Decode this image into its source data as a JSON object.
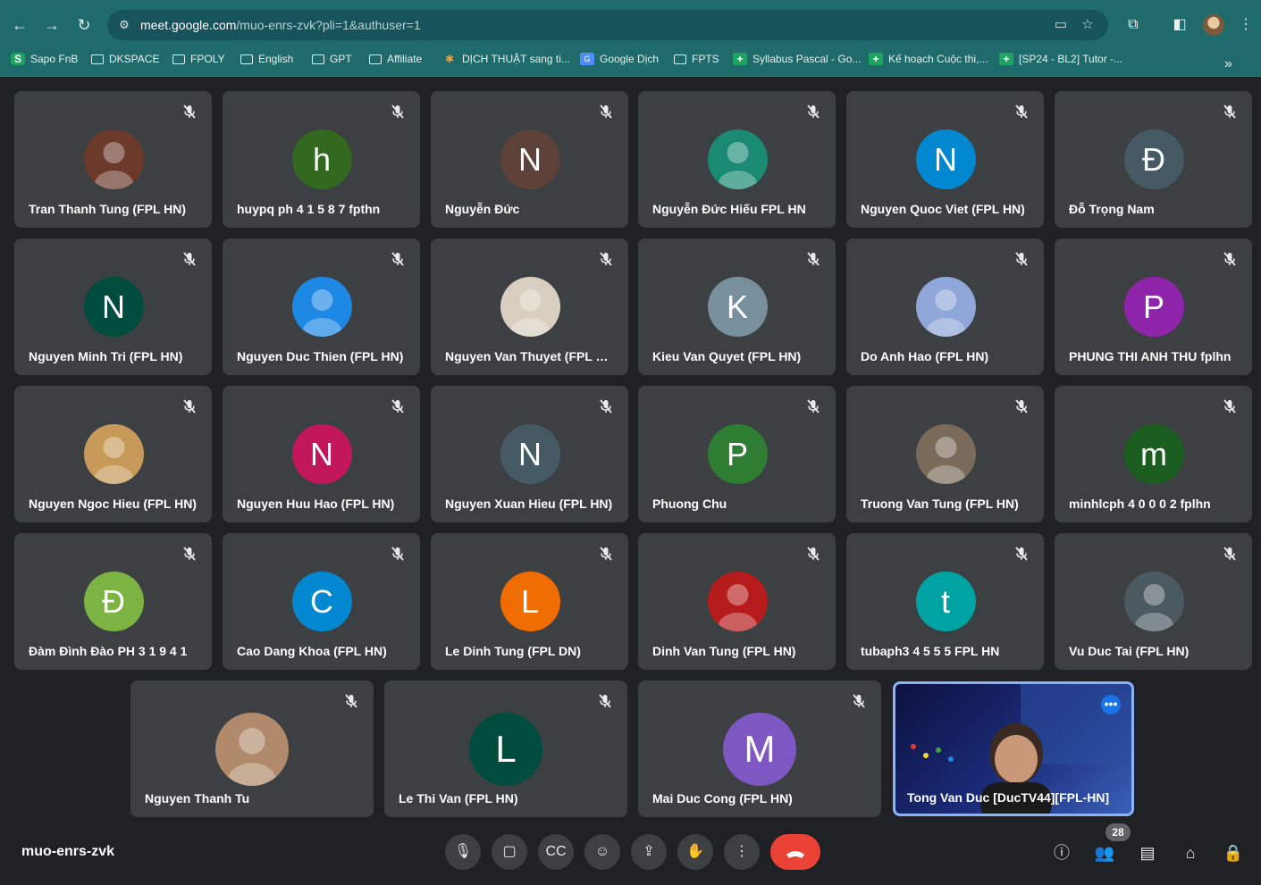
{
  "browser": {
    "url_host": "meet.google.com",
    "url_path": "/muo-enrs-zvk?pli=1&authuser=1"
  },
  "bookmarks": [
    {
      "label": "Sapo FnB",
      "icon": "sapo-icon"
    },
    {
      "label": "DKSPACE",
      "icon": "folder-icon"
    },
    {
      "label": "FPOLY",
      "icon": "folder-icon"
    },
    {
      "label": "English",
      "icon": "folder-icon"
    },
    {
      "label": "GPT",
      "icon": "folder-icon"
    },
    {
      "label": "Affiliate",
      "icon": "folder-icon"
    },
    {
      "label": "DỊCH THUẬT sang ti...",
      "icon": "translate-icon"
    },
    {
      "label": "Google Dịch",
      "icon": "google-translate-icon"
    },
    {
      "label": "FPTS",
      "icon": "folder-icon"
    },
    {
      "label": "Syllabus Pascal - Go...",
      "icon": "sheets-icon"
    },
    {
      "label": "Kế hoạch Cuộc thi,...",
      "icon": "sheets-icon"
    },
    {
      "label": "[SP24 - BL2] Tutor -...",
      "icon": "sheets-icon"
    }
  ],
  "participants": [
    {
      "name": "Tran Thanh Tung (FPL HN)",
      "initial": "",
      "color": "#6b3a2a"
    },
    {
      "name": "huypq ph 4 1 5 8 7 fpthn",
      "initial": "h",
      "color": "#33691e"
    },
    {
      "name": "Nguyễn Đức",
      "initial": "N",
      "color": "#5d4037"
    },
    {
      "name": "Nguyễn Đức Hiếu FPL HN",
      "initial": "",
      "color": "#1a8a73"
    },
    {
      "name": "Nguyen Quoc Viet (FPL HN)",
      "initial": "N",
      "color": "#0288d1"
    },
    {
      "name": "Đỗ Trọng Nam",
      "initial": "Đ",
      "color": "#455a64"
    },
    {
      "name": "Nguyen Minh Tri (FPL HN)",
      "initial": "N",
      "color": "#004d40"
    },
    {
      "name": "Nguyen Duc Thien (FPL HN)",
      "initial": "",
      "color": "#1e88e5"
    },
    {
      "name": "Nguyen Van Thuyet (FPL H...",
      "initial": "",
      "color": "#d8cfc0"
    },
    {
      "name": "Kieu Van Quyet (FPL HN)",
      "initial": "K",
      "color": "#78909c"
    },
    {
      "name": "Do Anh Hao (FPL HN)",
      "initial": "",
      "color": "#8fa6d8"
    },
    {
      "name": "PHUNG THI ANH THU fplhn",
      "initial": "P",
      "color": "#8e24aa"
    },
    {
      "name": "Nguyen Ngoc Hieu (FPL HN)",
      "initial": "",
      "color": "#c89a5a"
    },
    {
      "name": "Nguyen Huu Hao (FPL HN)",
      "initial": "N",
      "color": "#c2185b"
    },
    {
      "name": "Nguyen Xuan Hieu (FPL HN)",
      "initial": "N",
      "color": "#455a64"
    },
    {
      "name": "Phuong Chu",
      "initial": "P",
      "color": "#2e7d32"
    },
    {
      "name": "Truong Van Tung (FPL HN)",
      "initial": "",
      "color": "#7a6a5a"
    },
    {
      "name": "minhlcph 4 0 0 0 2 fplhn",
      "initial": "m",
      "color": "#1b5e20"
    },
    {
      "name": "Đàm Đình Đào PH 3 1 9 4 1",
      "initial": "Đ",
      "color": "#7cb342"
    },
    {
      "name": "Cao Dang Khoa (FPL HN)",
      "initial": "C",
      "color": "#0288d1"
    },
    {
      "name": "Le Dinh Tung (FPL DN)",
      "initial": "L",
      "color": "#ef6c00"
    },
    {
      "name": "Dinh Van Tung (FPL HN)",
      "initial": "",
      "color": "#b71c1c"
    },
    {
      "name": "tubaph3 4 5 5 5 FPL HN",
      "initial": "t",
      "color": "#00a3a3"
    },
    {
      "name": "Vu Duc Tai (FPL HN)",
      "initial": "",
      "color": "#4a5a60"
    },
    {
      "name": "Nguyen Thanh Tu",
      "initial": "",
      "color": "#b08a6a"
    },
    {
      "name": "Le Thi Van (FPL HN)",
      "initial": "L",
      "color": "#004d40"
    },
    {
      "name": "Mai Duc Cong (FPL HN)",
      "initial": "M",
      "color": "#7e57c2"
    }
  ],
  "self": {
    "name": "Tong Van Duc [DucTV44][FPL-HN]"
  },
  "meeting": {
    "code": "muo-enrs-zvk",
    "participant_count": "28"
  }
}
